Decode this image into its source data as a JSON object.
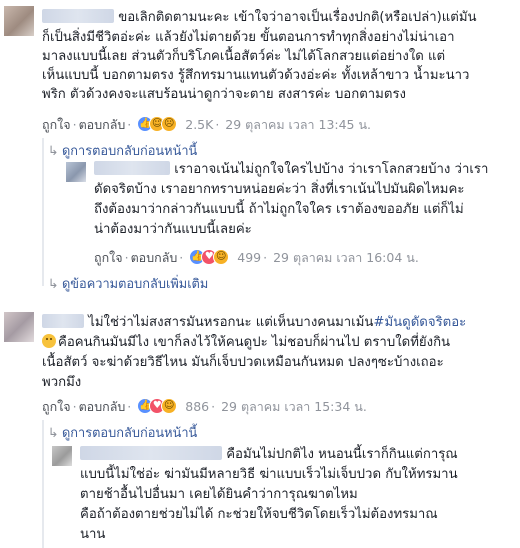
{
  "comments": [
    {
      "lines": [
        "ขอเลิกติดตามนะคะ เข้าใจว่าอาจเป็นเรื่องปกติ(หรือเปล่า)แต่มัน",
        "ก็เป็นสิ่งมีชีวิตอ่ะค่ะ แล้วยังไม่ตายด้วย ขั้นตอนการทำทุกสิ่งอย่างไม่น่าเอา",
        "มาลงแบบนี้เลย ส่วนตัวก็บริโภคเนื้อสัตว์ค่ะ ไม่ได้โลกสวยแต่อย่างใด แต่",
        "เห็นแบบนี้ บอกตามตรง รู้สึกทรมานแทนตัวด้วงอ่ะค่ะ ทั้งเหล้าขาว น้ำมะนาว",
        "พริก ตัวด้วงคงจะแสบร้อนน่าดูกว่าจะตาย สงสารค่ะ บอกตามตรง"
      ],
      "like_label": "ถูกใจ",
      "reply_label": "ตอบกลับ",
      "reaction_count": "2.5K",
      "timestamp": "29 ตุลาคม เวลา 13:45 น."
    }
  ],
  "previous_replies_1": "ดูการตอบกลับก่อนหน้านี้",
  "reply_1": {
    "lines": [
      "เราอาจเน้นไม่ถูกใจใครไปบ้าง ว่าเราโลกสวยบ้าง ว่าเรา",
      "ดัดจริตบ้าง เราอยากทราบหน่อยค่ะว่า สิ่งที่เราเน้นไปมันผิดไหมคะ",
      "ถึงต้องมาว่ากล่าวกันแบบนี้ ถ้าไม่ถูกใจใคร เราต้องขออภัย แต่ก็ไม่",
      "น่าต้องมาว่ากันแบบนี้เลยค่ะ"
    ],
    "like_label": "ถูกใจ",
    "reply_label": "ตอบกลับ",
    "reaction_count": "499",
    "timestamp": "29 ตุลาคม เวลา 16:04 น."
  },
  "more_replies": "ดูข้อความตอบกลับเพิ่มเติม",
  "comment_2": {
    "line1_text": "ไม่ใช่ว่าไม่สงสารมันหรอกนะ แต่เห็นบางคนมาเม้น",
    "line1_tag": "#มันดูดัดจริตอะ",
    "lines": [
      "คือคนกินมันมีไง เขาก็ลงไว้ให้คนดูปะ ไม่ชอบก็ผ่านไป ตราบใดที่ยังกิน",
      "เนื้อสัตว์ จะฆ่าด้วยวิธีไหน มันก็เจ็บปวดเหมือนกันหมด ปลงๆซะบ้างเถอะ",
      "พวกมึง"
    ],
    "like_label": "ถูกใจ",
    "reply_label": "ตอบกลับ",
    "reaction_count": "886",
    "timestamp": "29 ตุลาคม เวลา 15:34 น."
  },
  "previous_replies_2": "ดูการตอบกลับก่อนหน้านี้",
  "reply_2": {
    "lines": [
      "คือมันไม่ปกติไง หนอนนี้เราก็กินแต่การุณ",
      "แบบนี้ไม่ใช่อ่ะ ฆ่ามันมีหลายวิธี ฆ่าแบบเร็วไม่เจ็บปวด กับให้ทรมาน",
      "ตายช้าอื้นไปอื่นมา เคยได้ยินคำว่าการุณฆาตไหม",
      "คือถ้าต้องตายช่วยไม่ได้ กะช่วยให้จบชีวิตโดยเร็วไม่ต้องทรมาณ",
      "นาน"
    ]
  },
  "icons": {
    "like": "like-reaction-icon",
    "haha": "haha-reaction-icon",
    "sad": "sad-reaction-icon",
    "love": "love-reaction-icon",
    "reply_arrow": "reply-arrow-icon"
  },
  "colors": {
    "link": "#365899",
    "text": "#1d2129",
    "meta": "#90949c"
  }
}
